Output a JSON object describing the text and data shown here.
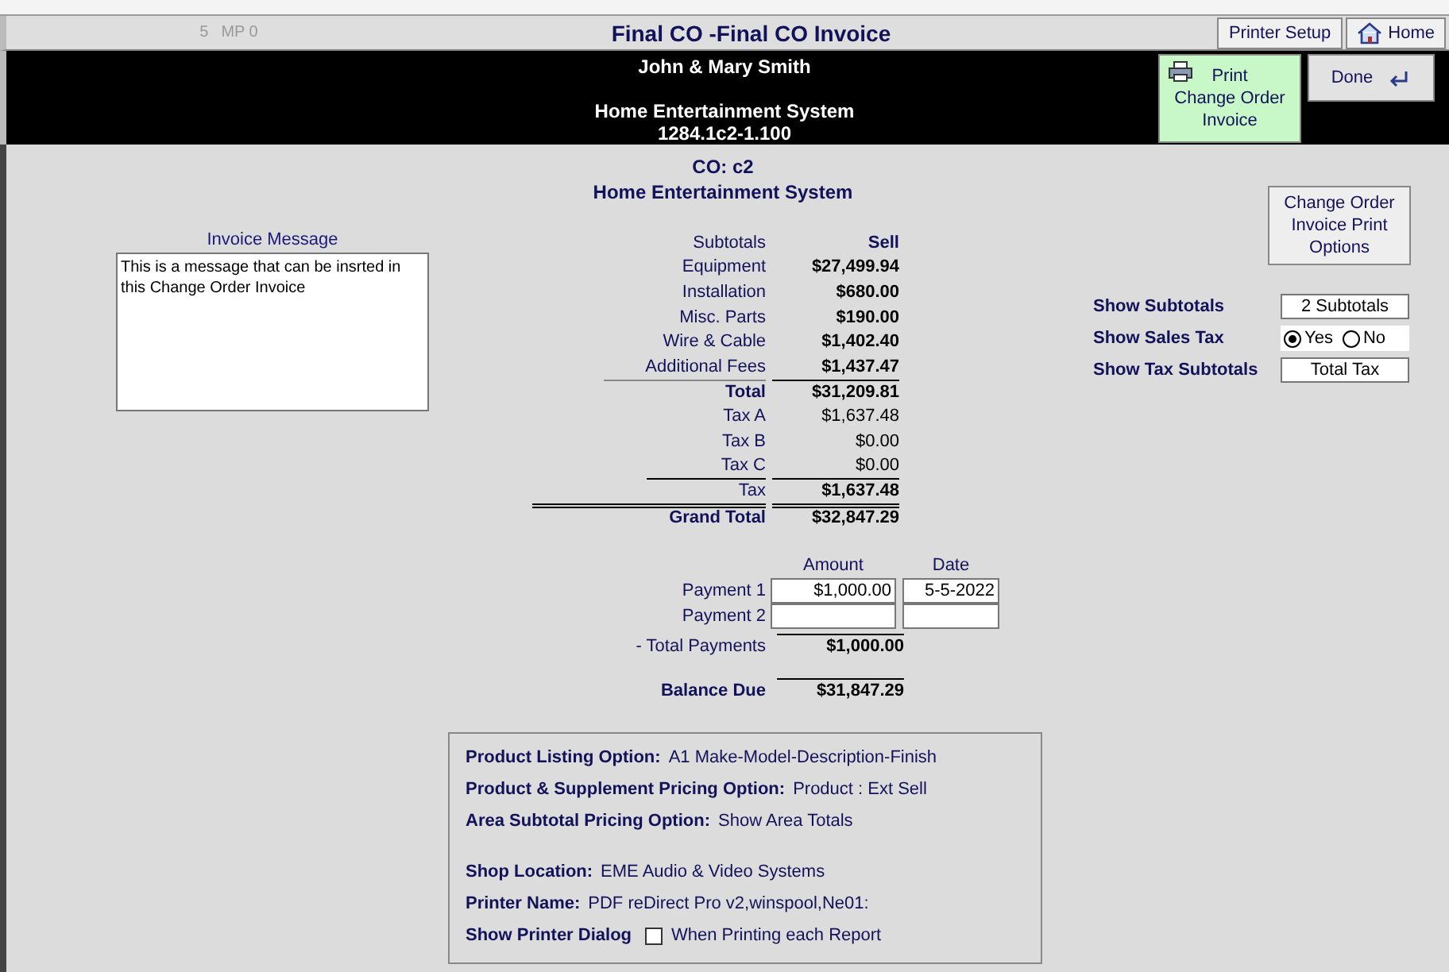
{
  "title_bar": {
    "indicator_1": "5",
    "indicator_2": "MP 0",
    "title": "Final CO -Final CO Invoice",
    "buttons": [
      {
        "label": "Printer Setup",
        "kind": "plain"
      },
      {
        "label": "Home",
        "kind": "home"
      }
    ]
  },
  "header": {
    "client": "John & Mary Smith",
    "project": "Home Entertainment System",
    "job_number": "1284.1c2-1.100",
    "print_button": [
      "Print",
      "Change Order",
      "Invoice"
    ],
    "done_button": "Done"
  },
  "co_heading": {
    "co": "CO: c2",
    "project": "Home Entertainment System"
  },
  "invoice_message": {
    "label": "Invoice Message",
    "value": "This is a message that can be insrted in this Change Order Invoice"
  },
  "subtotals": {
    "header_label": "Subtotals",
    "header_value": "Sell",
    "rows": [
      {
        "label": "Equipment",
        "value": "$27,499.94",
        "kind": "item"
      },
      {
        "label": "Installation",
        "value": "$680.00",
        "kind": "item"
      },
      {
        "label": "Misc. Parts",
        "value": "$190.00",
        "kind": "item"
      },
      {
        "label": "Wire & Cable",
        "value": "$1,402.40",
        "kind": "item"
      },
      {
        "label": "Additional Fees",
        "value": "$1,437.47",
        "kind": "item"
      },
      {
        "label": "Total",
        "value": "$31,209.81",
        "kind": "total"
      },
      {
        "label": "Tax A",
        "value": "$1,637.48",
        "kind": "tax"
      },
      {
        "label": "Tax B",
        "value": "$0.00",
        "kind": "tax"
      },
      {
        "label": "Tax C",
        "value": "$0.00",
        "kind": "tax"
      },
      {
        "label": "Tax",
        "value": "$1,637.48",
        "kind": "tax_total"
      },
      {
        "label": "Grand Total",
        "value": "$32,847.29",
        "kind": "grand"
      }
    ]
  },
  "payments": {
    "columns": [
      "Amount",
      "Date"
    ],
    "rows": [
      {
        "label": "Payment 1",
        "amount": "$1,000.00",
        "date": "5-5-2022"
      },
      {
        "label": "Payment 2"
      }
    ],
    "total_label": "- Total Payments",
    "total_value": "$1,000.00",
    "balance_label": "Balance Due",
    "balance_value": "$31,847.29"
  },
  "print_options_button": [
    "Change Order",
    "Invoice Print",
    "Options"
  ],
  "options": [
    {
      "label": "Show Subtotals",
      "kind": "select",
      "value": "2 Subtotals"
    },
    {
      "label": "Show Sales Tax",
      "kind": "radio",
      "choices": [
        {
          "label": "Yes",
          "selected": true
        },
        {
          "label": "No",
          "selected": false
        }
      ]
    },
    {
      "label": "Show Tax Subtotals",
      "kind": "select",
      "value": "Total Tax"
    }
  ],
  "settings_box": {
    "pricing_rows": [
      {
        "label": "Product Listing Option:",
        "value": "A1 Make-Model-Description-Finish"
      },
      {
        "label": "Product & Supplement Pricing Option:",
        "value": "Product : Ext Sell"
      },
      {
        "label": "Area Subtotal Pricing Option:",
        "value": "Show Area Totals"
      }
    ],
    "shop_rows": [
      {
        "label": "Shop Location:",
        "value": "EME Audio & Video Systems"
      },
      {
        "label": "Printer Name:",
        "value": "PDF reDirect Pro v2,winspool,Ne01:"
      }
    ],
    "printer_dialog": {
      "label": "Show Printer Dialog",
      "checked": false,
      "note": "When Printing each Report"
    }
  }
}
